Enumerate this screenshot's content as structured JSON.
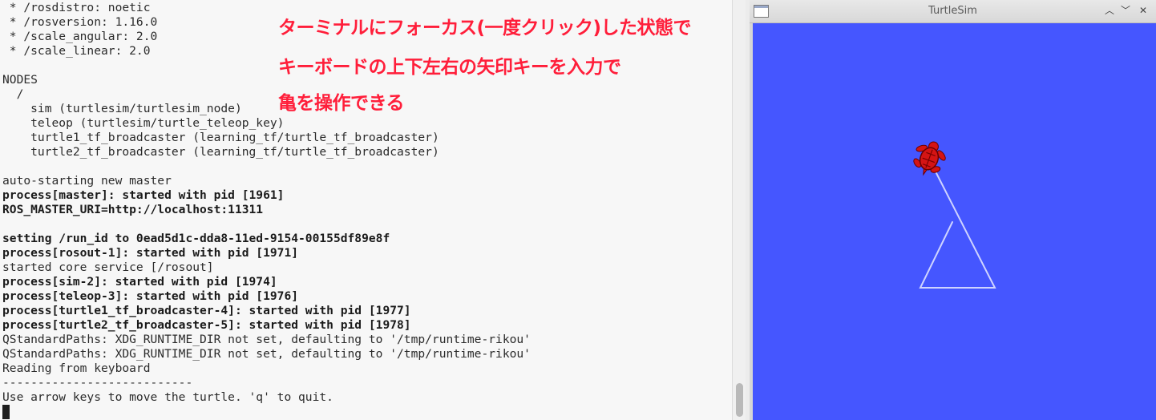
{
  "terminal": {
    "lines": [
      {
        "text": " * /rosdistro: noetic",
        "bold": false
      },
      {
        "text": " * /rosversion: 1.16.0",
        "bold": false
      },
      {
        "text": " * /scale_angular: 2.0",
        "bold": false
      },
      {
        "text": " * /scale_linear: 2.0",
        "bold": false
      },
      {
        "text": "",
        "bold": false
      },
      {
        "text": "NODES",
        "bold": false
      },
      {
        "text": "  /",
        "bold": false
      },
      {
        "text": "    sim (turtlesim/turtlesim_node)",
        "bold": false
      },
      {
        "text": "    teleop (turtlesim/turtle_teleop_key)",
        "bold": false
      },
      {
        "text": "    turtle1_tf_broadcaster (learning_tf/turtle_tf_broadcaster)",
        "bold": false
      },
      {
        "text": "    turtle2_tf_broadcaster (learning_tf/turtle_tf_broadcaster)",
        "bold": false
      },
      {
        "text": "",
        "bold": false
      },
      {
        "text": "auto-starting new master",
        "bold": false
      },
      {
        "text": "process[master]: started with pid [1961]",
        "bold": true
      },
      {
        "text": "ROS_MASTER_URI=http://localhost:11311",
        "bold": true
      },
      {
        "text": "",
        "bold": false
      },
      {
        "text": "setting /run_id to 0ead5d1c-dda8-11ed-9154-00155df89e8f",
        "bold": true
      },
      {
        "text": "process[rosout-1]: started with pid [1971]",
        "bold": true
      },
      {
        "text": "started core service [/rosout]",
        "bold": false
      },
      {
        "text": "process[sim-2]: started with pid [1974]",
        "bold": true
      },
      {
        "text": "process[teleop-3]: started with pid [1976]",
        "bold": true
      },
      {
        "text": "process[turtle1_tf_broadcaster-4]: started with pid [1977]",
        "bold": true
      },
      {
        "text": "process[turtle2_tf_broadcaster-5]: started with pid [1978]",
        "bold": true
      },
      {
        "text": "QStandardPaths: XDG_RUNTIME_DIR not set, defaulting to '/tmp/runtime-rikou'",
        "bold": false
      },
      {
        "text": "QStandardPaths: XDG_RUNTIME_DIR not set, defaulting to '/tmp/runtime-rikou'",
        "bold": false
      },
      {
        "text": "Reading from keyboard",
        "bold": false
      },
      {
        "text": "---------------------------",
        "bold": false
      },
      {
        "text": "Use arrow keys to move the turtle. 'q' to quit.",
        "bold": false
      }
    ]
  },
  "annotation": {
    "line1": "ターミナルにフォーカス(一度クリック)した状態で",
    "line2": "キーボードの上下左右の矢印キーを入力で",
    "line3": "亀を操作できる",
    "color": "#ff1e3a"
  },
  "turtlesim": {
    "title": "TurtleSim",
    "background_color": "#4556ff",
    "path_color": "#cfd4ff",
    "turtle_color": "#d41414",
    "buttons": {
      "shade_icon": "chevron-up-icon",
      "minimize_icon": "minimize-icon",
      "close_icon": "close-icon"
    }
  }
}
